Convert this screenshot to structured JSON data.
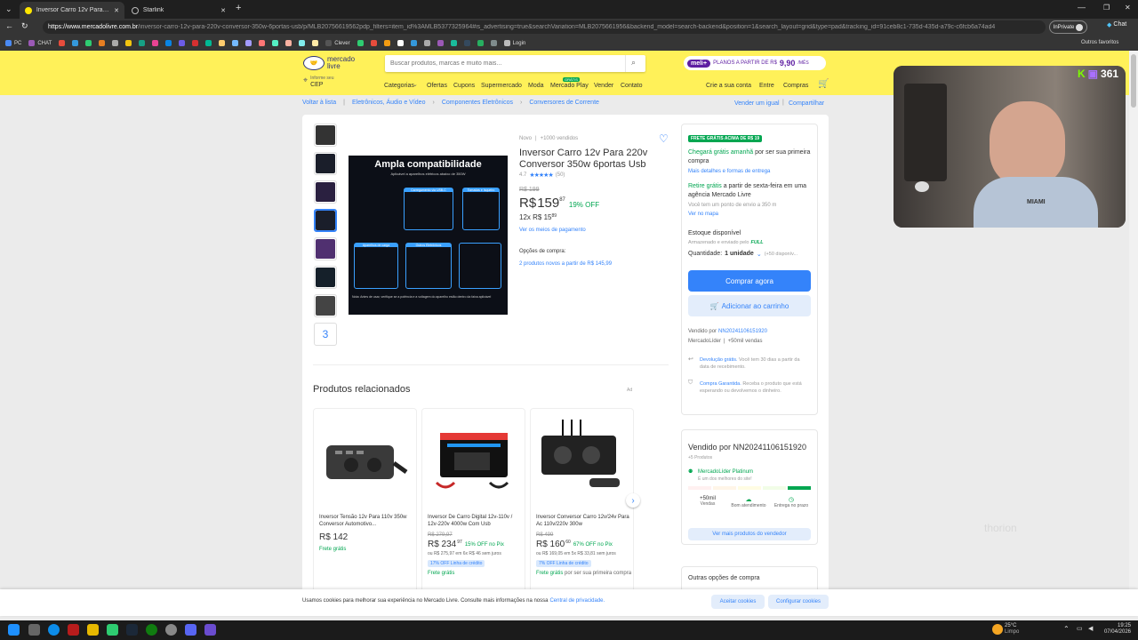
{
  "browser": {
    "tabs": [
      {
        "label": "Inversor Carro 12v Para 220v Conv",
        "active": true
      },
      {
        "label": "Starlink",
        "active": false
      }
    ],
    "url_host": "https://www.mercadolivre.com.br",
    "url_path": "/inversor-carro-12v-para-220v-conversor-350w-6portas-usb/p/MLB20756619562pdp_filters=item_id%3AMLB5377325964#is_advertising=true&searchVariation=MLB2075661956&backend_model=search-backend&position=1&search_layout=grid&type=pad&tracking_id=91ceb8c1-735d-435d-a79c-c6fcb6a74ad4",
    "inprivate": "InPrivate",
    "chat_btn": "Chat",
    "bookmarks": [
      {
        "label": "PC",
        "color": "#4a8af4"
      },
      {
        "label": "CHAT",
        "color": "#9b59b6"
      },
      {
        "label": "",
        "color": "#e74c3c"
      },
      {
        "label": "",
        "color": "#3498db"
      },
      {
        "label": "",
        "color": "#2ecc71"
      },
      {
        "label": "",
        "color": "#e67e22"
      },
      {
        "label": "",
        "color": "#aaa"
      },
      {
        "label": "",
        "color": "#f1c40f"
      },
      {
        "label": "",
        "color": "#16a085"
      },
      {
        "label": "",
        "color": "#e84393"
      },
      {
        "label": "",
        "color": "#0984e3"
      },
      {
        "label": "",
        "color": "#6c5ce7"
      },
      {
        "label": "",
        "color": "#d63031"
      },
      {
        "label": "",
        "color": "#00b894"
      },
      {
        "label": "",
        "color": "#fdcb6e"
      },
      {
        "label": "",
        "color": "#74b9ff"
      },
      {
        "label": "",
        "color": "#a29bfe"
      },
      {
        "label": "",
        "color": "#ff7675"
      },
      {
        "label": "",
        "color": "#55efc4"
      },
      {
        "label": "",
        "color": "#fab1a0"
      },
      {
        "label": "",
        "color": "#81ecec"
      },
      {
        "label": "",
        "color": "#ffeaa7"
      },
      {
        "label": "Clever",
        "color": "#555"
      },
      {
        "label": "",
        "color": "#2ecc71"
      },
      {
        "label": "",
        "color": "#e74c3c"
      },
      {
        "label": "",
        "color": "#f39c12"
      },
      {
        "label": "",
        "color": "#fff"
      },
      {
        "label": "",
        "color": "#3498db"
      },
      {
        "label": "",
        "color": "#aaa"
      },
      {
        "label": "",
        "color": "#9b59b6"
      },
      {
        "label": "",
        "color": "#1abc9c"
      },
      {
        "label": "",
        "color": "#34495e"
      },
      {
        "label": "",
        "color": "#27ae60"
      },
      {
        "label": "",
        "color": "#7f8c8d"
      },
      {
        "label": "Login",
        "color": "#bbb"
      }
    ],
    "other_favorites": "Outros favoritos"
  },
  "header": {
    "logo_line1": "mercado",
    "logo_line2": "livre",
    "search_placeholder": "Buscar produtos, marcas e muito mais...",
    "meli_badge": "meli+",
    "meli_text": "PLANOS A PARTIR DE R$",
    "meli_price": "9,90",
    "meli_unit": "/MÊS",
    "cep_line1": "Informe seu",
    "cep_line2": "CEP",
    "nav": [
      "Categorias",
      "Ofertas",
      "Cupons",
      "Supermercado",
      "Moda",
      "Mercado Play",
      "Vender",
      "Contato"
    ],
    "play_badge": "GRÁTIS",
    "account": [
      "Crie a sua conta",
      "Entre",
      "Compras"
    ]
  },
  "breadcrumb": {
    "back": "Voltar à lista",
    "items": [
      "Eletrônicos, Áudio e Vídeo",
      "Componentes Eletrônicos",
      "Conversores de Corrente"
    ],
    "sell": "Vender um igual",
    "share": "Compartilhar"
  },
  "product": {
    "condition": "Novo",
    "sold": "+1000 vendidos",
    "title": "Inversor Carro 12v Para 220v Conversor 350w 6portas Usb",
    "rating": "4.7",
    "rating_stars": 4.7,
    "reviews": "(50)",
    "old_price": "R$ 199",
    "currency": "R$",
    "price": "159",
    "cents": "87",
    "discount": "19% OFF",
    "installments": "12x R$ 15",
    "installments_cents": "89",
    "payment_link": "Ver os meios de pagamento",
    "purchase_options_label": "Opções de compra:",
    "purchase_options_link": "2 produtos novos a partir de R$ 145,99",
    "thumb_more": "3",
    "image": {
      "heading": "Ampla compatibilidade",
      "subheading": "Aplicável a aparelhos elétricos abaixo de 350W",
      "section1": "Carregamento via USB-C",
      "section2": "Tomadas e Isqueiro",
      "section3": "Aparelhos de carga",
      "section4": "Outros Eletrônicos",
      "note": "Nota: Antes de usar, verifique se a potência e a voltagem do aparelho estão dentro da faixa aplicável"
    }
  },
  "buybox": {
    "free_tag": "FRETE GRÁTIS ACIMA DE R$ 19",
    "arrive_strong": "Chegará grátis amanhã",
    "arrive_rest": "por ser sua primeira compra",
    "arrive_link": "Mais detalhes e formas de entrega",
    "pickup_strong": "Retire grátis",
    "pickup_rest": "a partir de sexta-feira em uma agência Mercado Livre",
    "pickup_note": "Você tem um ponto de envio a 350 m",
    "map_link": "Ver no mapa",
    "stock": "Estoque disponível",
    "stored": "Armazenado e enviado pelo",
    "full": "FULL",
    "qty_label": "Quantidade:",
    "qty_value": "1 unidade",
    "qty_available": "(+50 disponív...",
    "buy_btn": "Comprar agora",
    "cart_btn": "Adicionar ao carrinho",
    "seller_prefix": "Vendido por",
    "seller": "NN20241106151920",
    "seller_level": "MercadoLíder",
    "seller_sales": "+50mil vendas",
    "return_link": "Devolução grátis.",
    "return_text": "Você tem 30 dias a partir da data de recebimento.",
    "warranty_link": "Compra Garantida.",
    "warranty_text": "Receba o produto que está esperando ou devolvemos o dinheiro."
  },
  "seller_card": {
    "title": "Vendido por NN20241106151920",
    "products": "+5 Produtos",
    "level": "MercadoLíder Platinum",
    "level_sub": "É um dos melhores do site!",
    "stats": [
      {
        "value": "+50mil",
        "label": "Vendas"
      },
      {
        "value": "",
        "label": "Bom atendimento"
      },
      {
        "value": "",
        "label": "Entrega no prazo"
      }
    ],
    "more_btn": "Ver mais produtos do vendedor",
    "other_options": "Outras opções de compra"
  },
  "related": {
    "title": "Produtos relacionados",
    "ad": "Ad",
    "cards": [
      {
        "title": "Inversor Tensão 12v Para 110v 350w Conversor Automotivo...",
        "old": "",
        "price": "R$ 142",
        "cents": "",
        "discount": "",
        "sub": "",
        "badge": "",
        "free": "Frete grátis",
        "free_extra": ""
      },
      {
        "title": "Inversor De Carro Digital 12v-110v / 12v-220v 4000w Com Usb",
        "old": "R$ 279,97",
        "price": "R$ 234",
        "cents": "97",
        "discount": "15% OFF no Pix",
        "sub": "ou R$ 275,97 em 6x R$ 46 sem juros",
        "badge": "17% OFF Linha de crédito",
        "free": "Frete grátis",
        "free_extra": ""
      },
      {
        "title": "Inversor Conversor Carro 12v/24v Para Ac 110v/220v 300w",
        "old": "R$ 499",
        "price": "R$ 160",
        "cents": "60",
        "discount": "67% OFF no Pix",
        "sub": "ou R$ 169,05 em 5x R$ 33,81 sem juros",
        "badge": "7% OFF Linha de crédito",
        "free": "Frete grátis",
        "free_extra": "por ser sua primeira compra"
      }
    ]
  },
  "cookie": {
    "text": "Usamos cookies para melhorar sua experiência no Mercado Livre. Consulte mais informações na nossa",
    "link": "Central de privacidade.",
    "accept": "Aceitar cookies",
    "config": "Configurar cookies"
  },
  "stream": {
    "viewers": "361",
    "shirt_text": "MIAMI",
    "overlay": "thorion"
  },
  "taskbar": {
    "weather_temp": "25°C",
    "weather_text": "Limpo",
    "time": "19:25",
    "date": "07/04/2026"
  },
  "colors": {
    "ml_yellow": "#fff159",
    "ml_blue": "#3483fa",
    "ml_green": "#00a650",
    "meli_purple": "#5e1ea2"
  }
}
